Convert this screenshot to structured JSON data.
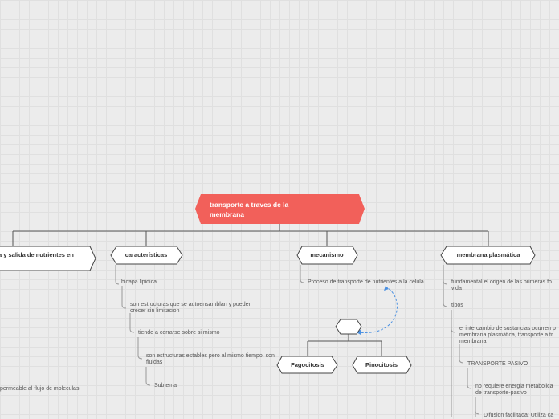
{
  "root": {
    "line1": "transporte a traves de la",
    "line2": "membrana",
    "color": "#f2605a"
  },
  "branches": {
    "entrada": "a y salida de nutrientes en",
    "caracteristicas": "características",
    "mecanismo": "mecanismo",
    "membrana": "membrana plasmática"
  },
  "caracteristicas_items": {
    "bicapa": "bicapa lipidica",
    "auto1": "son estructuras que se autoensamblan y pueden",
    "auto2": "crecer sin limitacion",
    "cerrarse": "tiende a cerrarse sobre si mismo",
    "estables1": "son estructuras estables pero al mismo tiempo, son",
    "estables2": "fluidas",
    "subtema": "Subtema"
  },
  "entrada_items": {
    "permeable": "permeable al flujo de moleculas"
  },
  "mecanismo_items": {
    "proceso": "Proceso de transporte de nutrientes a la celula",
    "fagocitosis": "Fagocitosis",
    "pinocitosis": "Pinocitosis"
  },
  "membrana_items": {
    "fundamental1": "fundamental el origen de las primeras fo",
    "fundamental2": "vida",
    "tipos": "tipos",
    "intercambio1": "el intercambio de sustancias ocurren p",
    "intercambio2": "membrana plasmática, transporte a tr",
    "intercambio3": "membrana",
    "pasivo": "TRANSPORTE PASIVO",
    "noreq1": "no requiere energia metabolica",
    "noreq2": "de transporte-pasivo",
    "difusion": "Difusion facilitada: Utiliza ca"
  },
  "colors": {
    "link": "#555555",
    "dashed": "#4a90e2",
    "node_border": "#444444"
  }
}
